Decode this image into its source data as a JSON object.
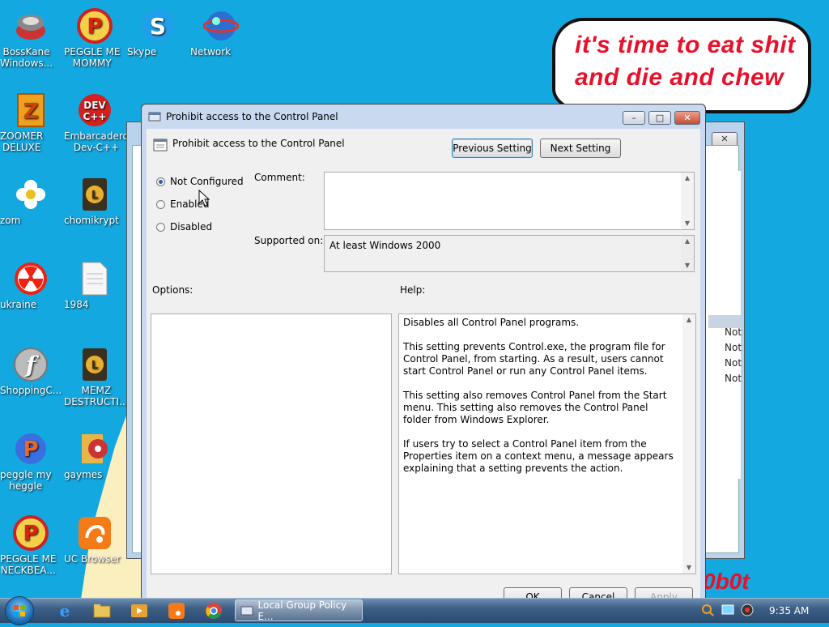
{
  "desktop": {
    "icons": [
      {
        "label": "BossKane\nWindows..."
      },
      {
        "label": "PEGGLE ME\nMOMMY"
      },
      {
        "label": "Skype"
      },
      {
        "label": "Network"
      },
      {
        "label": "ZOOMER\nDELUXE"
      },
      {
        "label": "Embarcadero\nDev-C++"
      },
      {
        "label": "zom"
      },
      {
        "label": "chomikrypt"
      },
      {
        "label": "ukraine"
      },
      {
        "label": "1984"
      },
      {
        "label": "ShoppingC..."
      },
      {
        "label": "MEMZ\nDESTRUCTI..."
      },
      {
        "label": "peggle my\nheggle"
      },
      {
        "label": "gaymes"
      },
      {
        "label": "PEGGLE ME\nNECKBEA..."
      },
      {
        "label": "UC Browser"
      }
    ],
    "bubble_text": "it's time to eat shit and die and chew",
    "scribble_text": "0b0t"
  },
  "back_window": {
    "status": [
      "Not",
      "Not",
      "Not",
      "Not"
    ],
    "close_label": "✕"
  },
  "dialog": {
    "title": "Prohibit access to the Control Panel",
    "header": "Prohibit access to the Control Panel",
    "prev_button": "Previous Setting",
    "next_button": "Next Setting",
    "radios": [
      {
        "label": "Not Configured",
        "selected": true
      },
      {
        "label": "Enabled",
        "selected": false
      },
      {
        "label": "Disabled",
        "selected": false
      }
    ],
    "comment_label": "Comment:",
    "comment_value": "",
    "supported_label": "Supported on:",
    "supported_value": "At least Windows 2000",
    "options_label": "Options:",
    "help_label": "Help:",
    "help_paragraphs": [
      "Disables all Control Panel programs.",
      "This setting prevents Control.exe, the program file for Control Panel, from starting. As a result, users cannot start Control Panel or run any Control Panel items.",
      "This setting also removes Control Panel from the Start menu. This setting also removes the Control Panel folder from Windows Explorer.",
      "If users try to select a Control Panel item from the Properties item on a context menu, a message appears explaining that a setting prevents the action."
    ],
    "ok_button": "OK",
    "cancel_button": "Cancel",
    "apply_button": "Apply"
  },
  "taskbar": {
    "task_label": "Local Group Policy E...",
    "clock": "9:35 AM"
  },
  "colors": {
    "desktop": "#14a8e0",
    "bubble_text": "#e8102a"
  }
}
